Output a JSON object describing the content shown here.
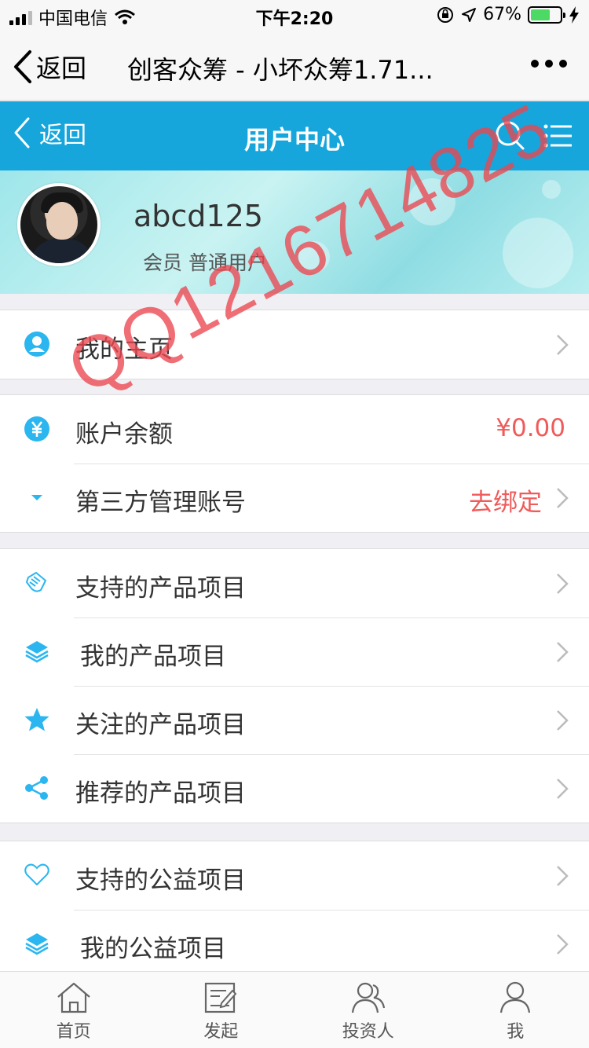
{
  "status_bar": {
    "carrier": "中国电信",
    "time": "下午2:20",
    "battery": "67%",
    "battery_level": 0.67
  },
  "top_nav": {
    "back_label": "返回",
    "title": "创客众筹 - 小坏众筹1.71..."
  },
  "app_header": {
    "back_label": "返回",
    "title": "用户中心"
  },
  "profile": {
    "username": "abcd125",
    "member_label": "会员",
    "member_level": "普通用户"
  },
  "groups": [
    [
      {
        "label": "我的主页",
        "icon": "user-circle-icon"
      }
    ],
    [
      {
        "label": "账户余额",
        "value": "¥0.00",
        "icon": "yen-icon"
      },
      {
        "label": "第三方管理账号",
        "value": "去绑定",
        "icon": "caret-down-icon"
      }
    ],
    [
      {
        "label": "支持的产品项目",
        "icon": "hand-icon"
      },
      {
        "label": "我的产品项目",
        "icon": "layers-icon"
      },
      {
        "label": "关注的产品项目",
        "icon": "star-icon"
      },
      {
        "label": "推荐的产品项目",
        "icon": "share-icon"
      }
    ],
    [
      {
        "label": "支持的公益项目",
        "icon": "heart-icon"
      },
      {
        "label": "我的公益项目",
        "icon": "layers-icon"
      }
    ]
  ],
  "watermark": "QQ1216714825",
  "tabs": [
    {
      "label": "首页",
      "icon": "home-icon"
    },
    {
      "label": "发起",
      "icon": "edit-icon"
    },
    {
      "label": "投资人",
      "icon": "users-icon"
    },
    {
      "label": "我",
      "icon": "person-icon"
    }
  ],
  "colors": {
    "accent": "#16a6dc",
    "value_red": "#f05a5a",
    "icon_blue": "#2bb6f0"
  }
}
